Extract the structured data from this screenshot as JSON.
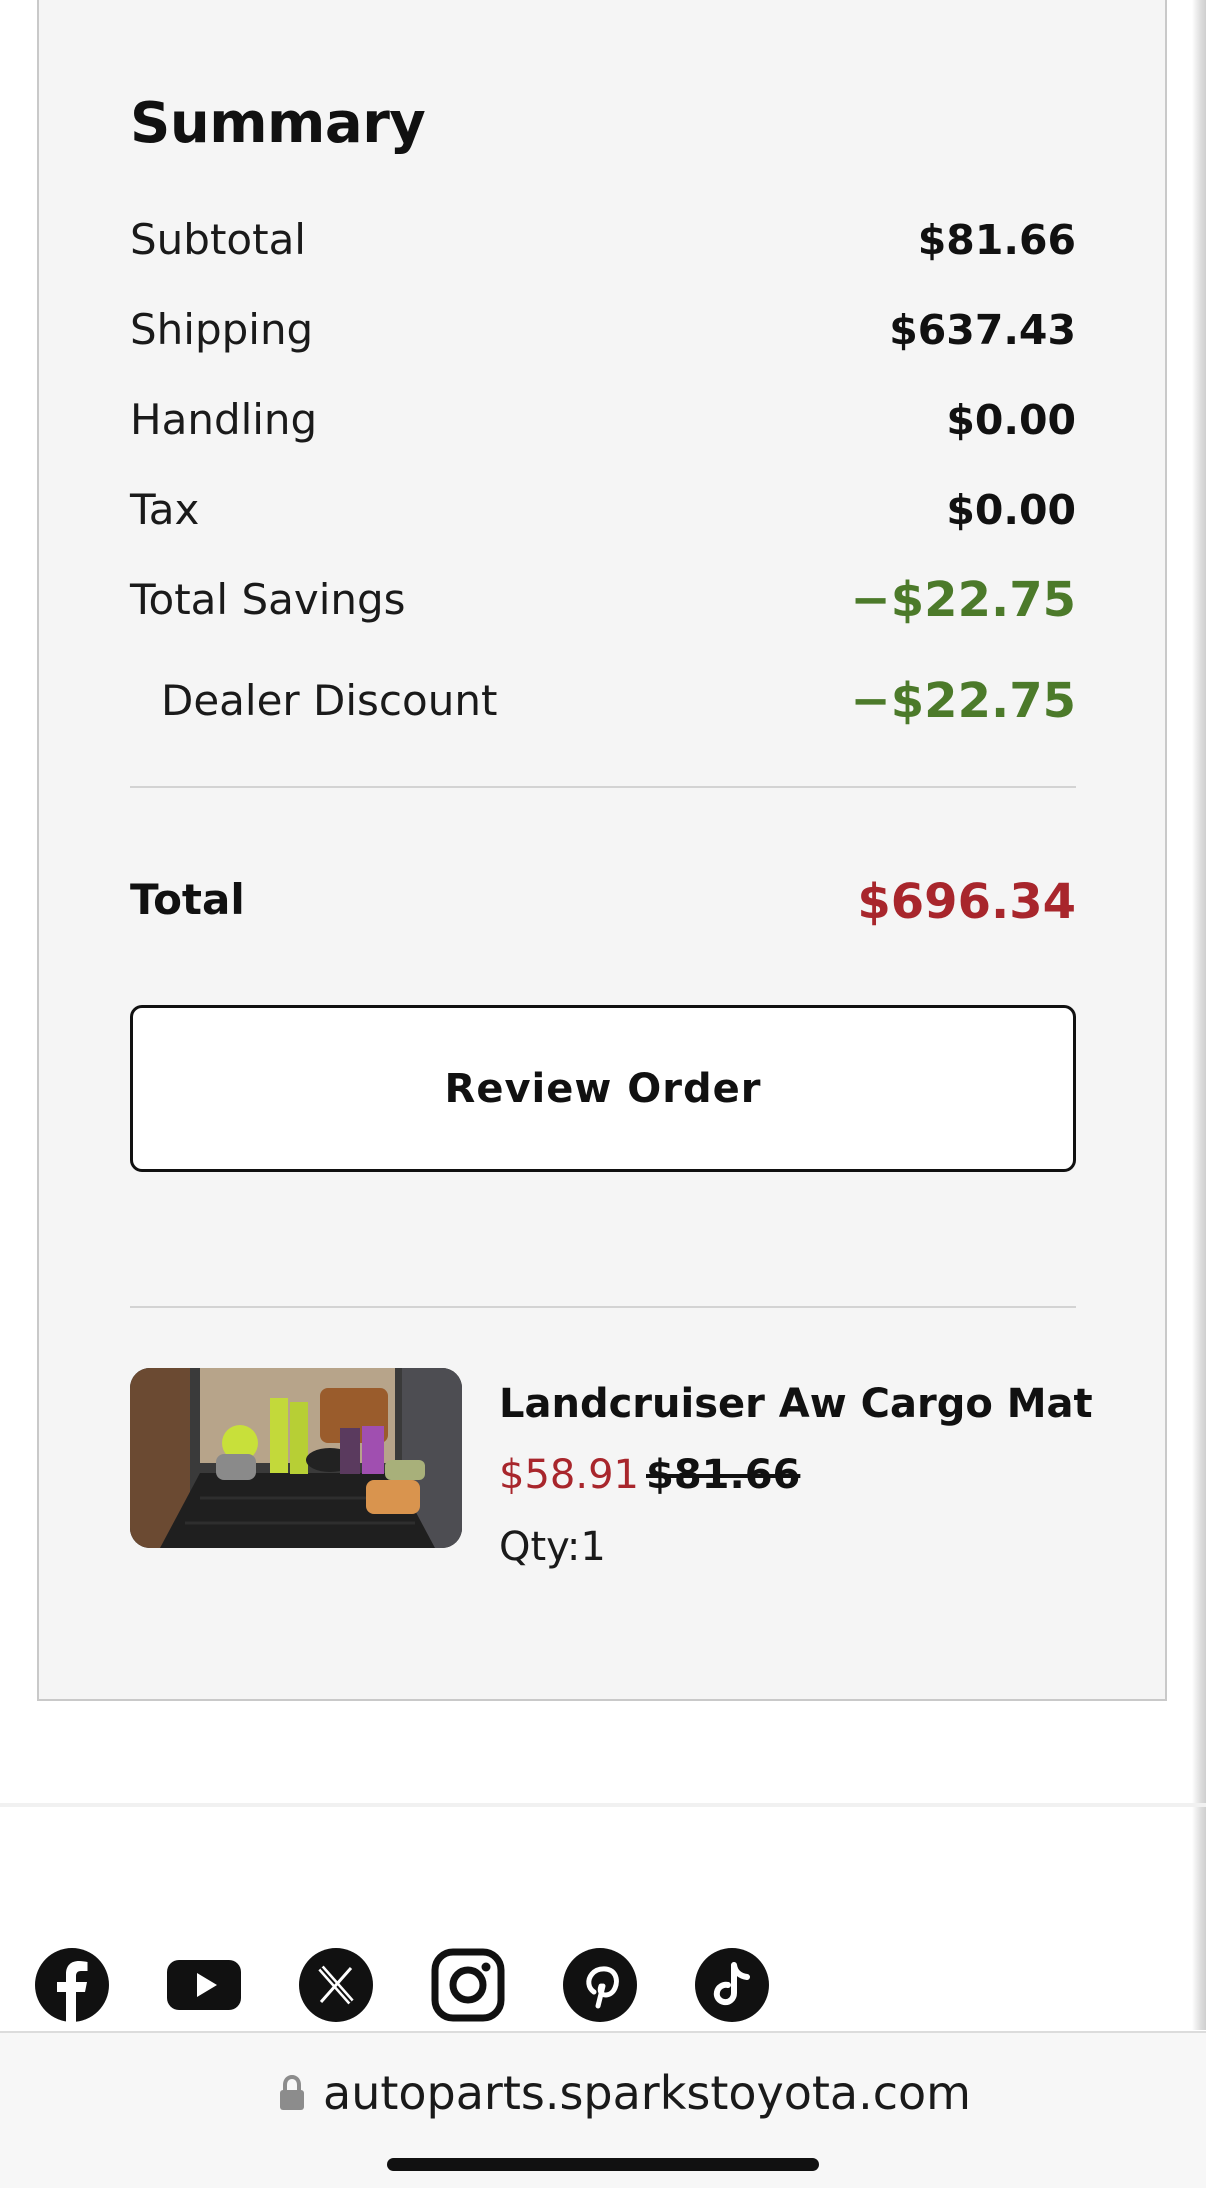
{
  "summary": {
    "title": "Summary",
    "rows": [
      {
        "label": "Subtotal",
        "value": "$81.66"
      },
      {
        "label": "Shipping",
        "value": "$637.43"
      },
      {
        "label": "Handling",
        "value": "$0.00"
      },
      {
        "label": "Tax",
        "value": "$0.00"
      },
      {
        "label": "Total Savings",
        "value": "−$22.75"
      },
      {
        "label": "Dealer Discount",
        "value": "−$22.75"
      }
    ],
    "total_label": "Total",
    "total_value": "$696.34",
    "review_button": "Review Order"
  },
  "item": {
    "name": "Landcruiser Aw Cargo Mat",
    "sale_price": "$58.91",
    "original_price": "$81.66",
    "qty": "Qty:1",
    "image_icon": "cargo-mat-photo"
  },
  "socials": [
    "facebook-icon",
    "youtube-icon",
    "x-icon",
    "instagram-icon",
    "pinterest-icon",
    "tiktok-icon"
  ],
  "browser": {
    "url": "autoparts.sparkstoyota.com"
  },
  "colors": {
    "savings": "#4c7a2a",
    "price_red": "#a8262c",
    "panel_bg": "#f5f5f5"
  }
}
